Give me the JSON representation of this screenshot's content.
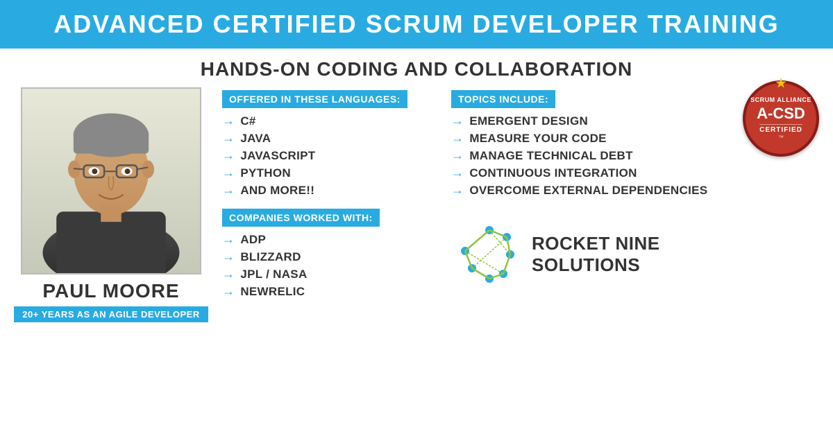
{
  "header": {
    "title": "ADVANCED CERTIFIED SCRUM DEVELOPER TRAINING"
  },
  "subtitle": {
    "text": "HANDS-ON CODING AND COLLABORATION"
  },
  "instructor": {
    "name": "PAUL MOORE",
    "years_label": "20+ YEARS AS AN AGILE DEVELOPER"
  },
  "languages": {
    "heading": "OFFERED IN THESE LANGUAGES:",
    "items": [
      "C#",
      "JAVA",
      "JAVASCRIPT",
      "PYTHON",
      "AND MORE!!"
    ]
  },
  "companies": {
    "heading": "COMPANIES WORKED WITH:",
    "items": [
      "ADP",
      "BLIZZARD",
      "JPL / NASA",
      "NEWRELIC"
    ]
  },
  "topics": {
    "heading": "TOPICS INCLUDE:",
    "items": [
      "EMERGENT DESIGN",
      "MEASURE YOUR CODE",
      "MANAGE TECHNICAL DEBT",
      "CONTINUOUS INTEGRATION",
      "OVERCOME EXTERNAL DEPENDENCIES"
    ]
  },
  "badge": {
    "top": "Scrum Alliance",
    "main": "A-CSD",
    "bottom": "CERTIFIED"
  },
  "logo": {
    "name": "ROCKET NINE\nSOLUTIONS"
  },
  "arrow": "→"
}
